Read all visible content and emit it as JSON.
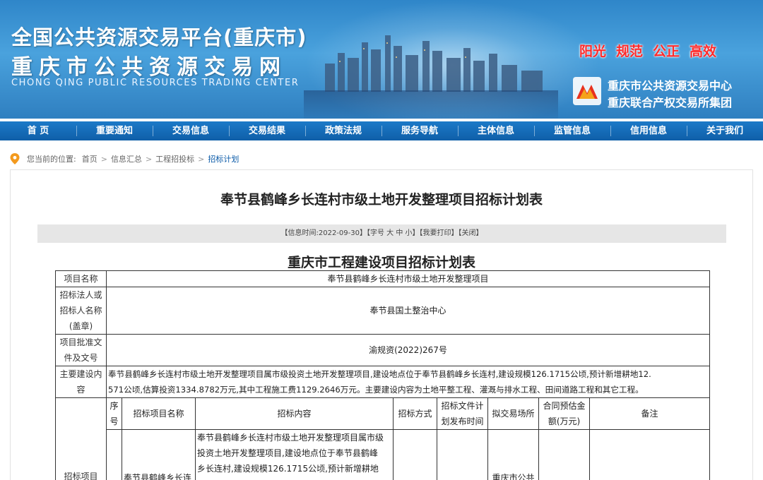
{
  "header": {
    "title_cn_1": "全国公共资源交易平台(重庆市)",
    "title_cn_2": "重庆市公共资源交易网",
    "title_en": "CHONG QING PUBLIC RESOURCES TRADING CENTER",
    "slogans": [
      "阳光",
      "规范",
      "公正",
      "高效"
    ],
    "center_name_1": "重庆市公共资源交易中心",
    "center_name_2": "重庆联合产权交易所集团",
    "logo_icon": "center-logo-icon"
  },
  "nav": {
    "items": [
      "首 页",
      "重要通知",
      "交易信息",
      "交易结果",
      "政策法规",
      "服务导航",
      "主体信息",
      "监管信息",
      "信用信息",
      "关于我们"
    ]
  },
  "breadcrumb": {
    "prefix": "您当前的位置:",
    "items": [
      "首页",
      "信息汇总",
      "工程招投标",
      "招标计划"
    ],
    "sep": ">"
  },
  "article": {
    "title": "奉节县鹤峰乡长连村市级土地开发整理项目招标计划表",
    "info": {
      "time": "【信息时间:2022-09-30】",
      "font": "【字号 大 中 小】",
      "print": "【我要打印】",
      "close": "【关闭】"
    }
  },
  "plan": {
    "title": "重庆市工程建设项目招标计划表",
    "rows": {
      "project_name_label": "项目名称",
      "project_name": "奉节县鹤峰乡长连村市级土地开发整理项目",
      "tenderer_label_1": "招标法人或",
      "tenderer_label_2": "招标人名称",
      "tenderer_label_3": "(盖章)",
      "tenderer": "奉节县国土整治中心",
      "approval_label_1": "项目批准文",
      "approval_label_2": "件及文号",
      "approval": "渝规资(2022)267号",
      "content_label_1": "主要建设内",
      "content_label_2": "容",
      "content_line_1": "奉节县鹤峰乡长连村市级土地开发整理项目属市级投资土地开发整理项目,建设地点位于奉节县鹤峰乡长连村,建设规模126.1715公顷,预计新增耕地12.",
      "content_line_2": "571公顷,估算投资1334.8782万元,其中工程施工费1129.2646万元。主要建设内容为土地平整工程、灌溉与排水工程、田间道路工程和其它工程。"
    },
    "sub_headers": {
      "seq_1": "序",
      "seq_2": "号",
      "name": "招标项目名称",
      "content": "招标内容",
      "method": "招标方式",
      "publish_1": "招标文件计",
      "publish_2": "划发布时间",
      "place": "拟交易场所",
      "amount_1": "合同预估金",
      "amount_2": "额(万元)",
      "remark": "备注"
    },
    "item_label": "招标项目",
    "item": {
      "name": "奉节县鹤峰乡长连",
      "content_1": "奉节县鹤峰乡长连村市级土地开发整理项目属市级",
      "content_2": "投资土地开发整理项目,建设地点位于奉节县鹤峰",
      "content_3": "乡长连村,建设规模126.1715公顷,预计新增耕地",
      "place": "重庆市公共"
    }
  }
}
